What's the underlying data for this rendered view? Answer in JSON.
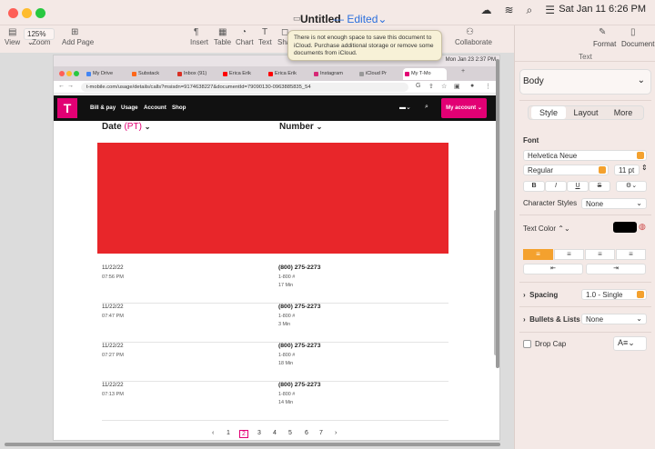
{
  "menubar": {
    "date": "Sat Jan 11  6:26 PM"
  },
  "window": {
    "title": "Untitled",
    "separator": "—",
    "status": "Edited",
    "status_chevron": "⌄"
  },
  "toolbar": {
    "view_label": "View",
    "zoom_value": "125%",
    "zoom_label": "Zoom",
    "add_page_label": "Add Page",
    "insert_label": "Insert",
    "table_label": "Table",
    "chart_label": "Chart",
    "text_label": "Text",
    "shape_label": "Sha",
    "collaborate_label": "Collaborate"
  },
  "tooltip": {
    "text": "There is not enough space to save this document to iCloud. Purchase additional storage or remove some documents from iCloud."
  },
  "inspector": {
    "format_label": "Format",
    "document_label": "Document",
    "subheading": "Text",
    "paragraph_style": "Body",
    "tabs": [
      "Style",
      "Layout",
      "More"
    ],
    "font_heading": "Font",
    "font_name": "Helvetica Neue",
    "font_weight": "Regular",
    "font_size": "11 pt",
    "bold": "B",
    "italic": "I",
    "underline": "U",
    "strike": "S",
    "char_styles_label": "Character Styles",
    "char_styles_value": "None",
    "text_color_label": "Text Color",
    "text_color_chevron": "⌃⌄",
    "text_color": "#000000",
    "spacing_label": "Spacing",
    "spacing_value": "1.0 - Single",
    "bullets_label": "Bullets & Lists",
    "bullets_value": "None",
    "drop_cap_label": "Drop Cap"
  },
  "screenshot": {
    "os_date": "Mon Jan 23  2:37 PM",
    "tabs": [
      {
        "label": "My Drive",
        "color": "#4285f4"
      },
      {
        "label": "Substack",
        "color": "#ff6719"
      },
      {
        "label": "Inbox (91)",
        "color": "#d93025"
      },
      {
        "label": "Erica Erik",
        "color": "#ff0000"
      },
      {
        "label": "Erica Erik",
        "color": "#ff0000"
      },
      {
        "label": "Instagram",
        "color": "#d62976"
      },
      {
        "label": "iCloud Pr",
        "color": "#999999"
      },
      {
        "label": "My T-Mo",
        "color": "#e20074"
      }
    ],
    "url": "t-mobile.com/usage/details/calls?msisdn=9174638227&documentId=79090130-0963885835_54",
    "nav": {
      "logo": "T",
      "links": [
        "Bill & pay",
        "Usage",
        "Account",
        "Shop"
      ],
      "account_button": "My account ⌄"
    },
    "columns": {
      "date_label": "Date",
      "date_tz": "(PT)",
      "number_label": "Number"
    },
    "rows": [
      {
        "date": "11/22/22",
        "time": "07:56 PM",
        "number": "(800) 275-2273",
        "type": "1-800 #",
        "duration": "17 Min"
      },
      {
        "date": "11/22/22",
        "time": "07:47 PM",
        "number": "(800) 275-2273",
        "type": "1-800 #",
        "duration": "3 Min"
      },
      {
        "date": "11/22/22",
        "time": "07:27 PM",
        "number": "(800) 275-2273",
        "type": "1-800 #",
        "duration": "18 Min"
      },
      {
        "date": "11/22/22",
        "time": "07:13 PM",
        "number": "(800) 275-2273",
        "type": "1-800 #",
        "duration": "14 Min"
      }
    ],
    "pagination": {
      "prev": "‹",
      "pages": [
        "1",
        "2",
        "3",
        "4",
        "5",
        "6",
        "7"
      ],
      "current": "2",
      "next": "›"
    },
    "redaction_color": "#e8262a"
  }
}
